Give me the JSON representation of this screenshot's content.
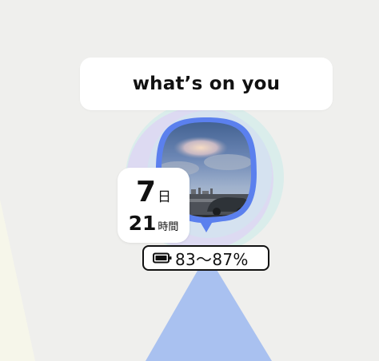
{
  "header": {
    "title": "what’s on you"
  },
  "avatar": {
    "description_icon": "photo-pin-icon"
  },
  "duration": {
    "days_value": "7",
    "days_unit": "日",
    "hours_value": "21",
    "hours_unit": "時間"
  },
  "battery": {
    "icon": "battery-icon",
    "range_text": "83～87%"
  },
  "colors": {
    "background": "#efefed",
    "pin_blue": "#5b80ee",
    "beam_blue": "#a9c1f0",
    "aura_teal": "#cfe8e6",
    "aura_violet": "#dcd3f3",
    "text": "#111111"
  }
}
